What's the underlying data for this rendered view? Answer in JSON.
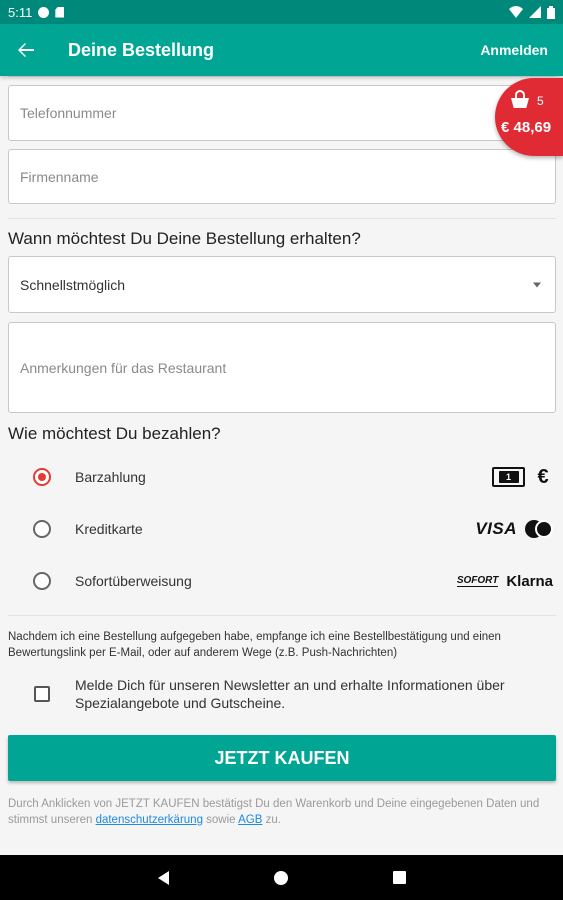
{
  "status_bar": {
    "time": "5:11"
  },
  "header": {
    "title": "Deine Bestellung",
    "login_label": "Anmelden"
  },
  "cart": {
    "count": "5",
    "total": "€ 48,69"
  },
  "form": {
    "phone_placeholder": "Telefonnummer",
    "company_placeholder": "Firmenname",
    "delivery_title": "Wann möchtest Du Deine Bestellung erhalten?",
    "delivery_selected": "Schnellstmöglich",
    "notes_placeholder": "Anmerkungen für das Restaurant",
    "payment_title": "Wie möchtest Du bezahlen?"
  },
  "payment_options": [
    {
      "label": "Barzahlung",
      "checked": true
    },
    {
      "label": "Kreditkarte",
      "checked": false
    },
    {
      "label": "Sofortüberweisung",
      "checked": false
    }
  ],
  "payment_logos": {
    "visa": "VISA",
    "sofort": "SOFORT",
    "klarna": "Klarna",
    "euro": "€"
  },
  "legal": {
    "confirmation_text": "Nachdem ich eine Bestellung aufgegeben habe, empfange ich eine Bestellbestätigung und einen Bewertungslink per E-Mail, oder auf anderem Wege (z.B. Push-Nachrichten)",
    "newsletter_text": "Melde Dich für unseren Newsletter an und erhalte Informationen über Spezialangebote und Gutscheine."
  },
  "buy_button_label": "JETZT KAUFEN",
  "footer": {
    "text_before": "Durch Anklicken von JETZT KAUFEN bestätigst Du den Warenkorb und Deine eingegebenen Daten und stimmst unseren ",
    "privacy_link": "datenschutzerkärung",
    "text_middle": " sowie ",
    "agb_link": "AGB",
    "text_after": " zu."
  }
}
